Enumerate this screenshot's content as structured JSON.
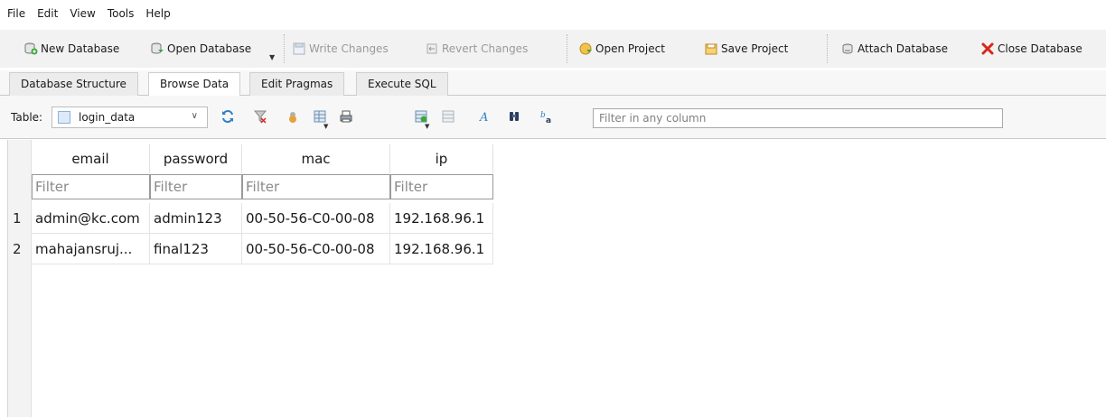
{
  "menu": [
    "File",
    "Edit",
    "View",
    "Tools",
    "Help"
  ],
  "toolbar": {
    "new_database": "New Database",
    "open_database": "Open Database",
    "write_changes": "Write Changes",
    "revert_changes": "Revert Changes",
    "open_project": "Open Project",
    "save_project": "Save Project",
    "attach_database": "Attach Database",
    "close_database": "Close Database"
  },
  "tabs": [
    "Database Structure",
    "Browse Data",
    "Edit Pragmas",
    "Execute SQL"
  ],
  "active_tab": "Browse Data",
  "browse": {
    "table_label": "Table:",
    "table_selected": "login_data",
    "filter_placeholder": "Filter in any column"
  },
  "grid": {
    "columns": [
      "email",
      "password",
      "mac",
      "ip"
    ],
    "filter_placeholder": "Filter",
    "rows": [
      {
        "num": "1",
        "cells": [
          "admin@kc.com",
          "admin123",
          "00-50-56-C0-00-08",
          "192.168.96.1"
        ]
      },
      {
        "num": "2",
        "cells": [
          "mahajansruj...",
          "final123",
          "00-50-56-C0-00-08",
          "192.168.96.1"
        ]
      }
    ]
  },
  "colors": {
    "close_red": "#d9261c",
    "toolbar_bg": "#f2f2f2"
  }
}
